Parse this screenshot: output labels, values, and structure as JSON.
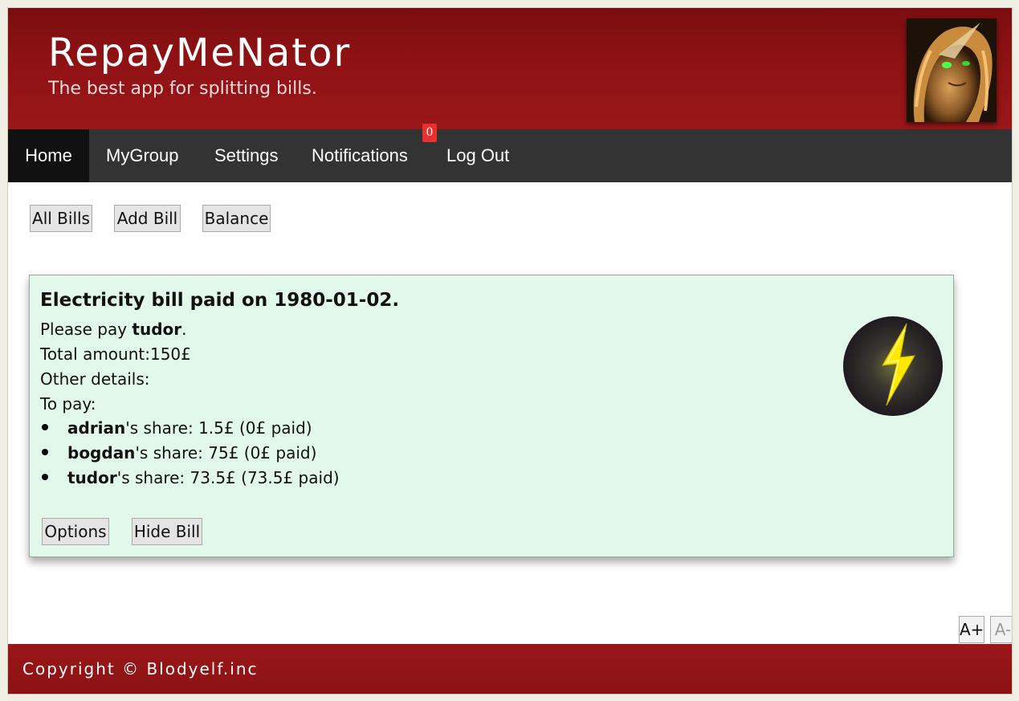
{
  "header": {
    "title": "RepayMeNator",
    "subtitle": "The best app for splitting bills."
  },
  "nav": {
    "items": [
      {
        "label": "Home",
        "active": true
      },
      {
        "label": "MyGroup"
      },
      {
        "label": "Settings"
      },
      {
        "label": "Notifications"
      },
      {
        "label": "Log Out"
      }
    ],
    "notifications_count": "0"
  },
  "toolbar": {
    "all_bills": "All Bills",
    "add_bill": "Add Bill",
    "balance": "Balance"
  },
  "bill": {
    "title": "Electricity bill paid on 1980-01-02.",
    "please_pay_prefix": "Please pay ",
    "payee": "tudor",
    "please_pay_suffix": ".",
    "total": "Total amount:150£",
    "other_details": "Other details:",
    "to_pay": "To pay:",
    "shares": [
      {
        "name": "adrian",
        "text": "'s share: 1.5£ (0£ paid)"
      },
      {
        "name": "bogdan",
        "text": "'s share: 75£ (0£ paid)"
      },
      {
        "name": "tudor",
        "text": "'s share: 73.5£ (73.5£ paid)"
      }
    ],
    "options_label": "Options",
    "hide_label": "Hide Bill",
    "icon": "lightning-bolt-icon"
  },
  "font_controls": {
    "increase": "A+",
    "decrease": "A-"
  },
  "footer": {
    "copyright": "Copyright © Blodyelf.inc"
  },
  "colors": {
    "header_red": "#8f1214",
    "nav_bg": "#333333",
    "nav_active": "#111111",
    "card_bg": "#e2f8ea",
    "badge_red": "#e8312f"
  }
}
